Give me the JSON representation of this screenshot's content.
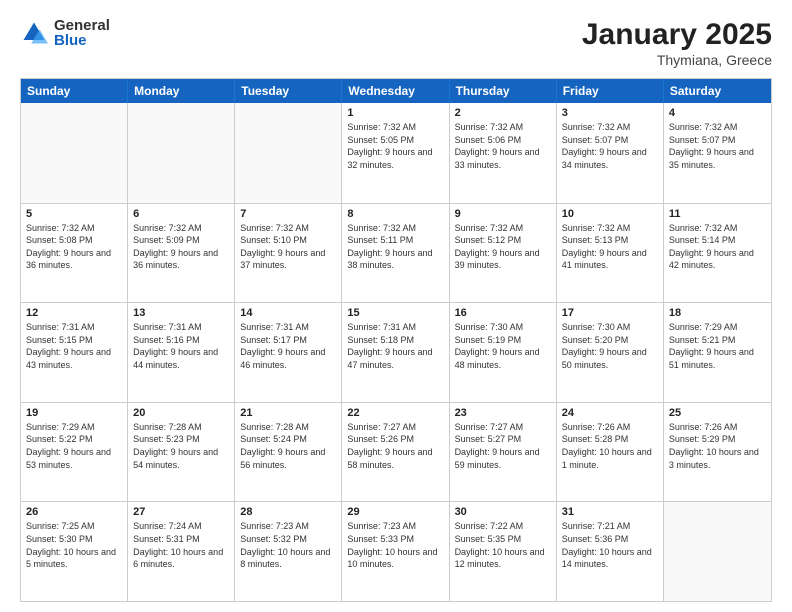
{
  "header": {
    "logo_general": "General",
    "logo_blue": "Blue",
    "title": "January 2025",
    "location": "Thymiana, Greece"
  },
  "weekdays": [
    "Sunday",
    "Monday",
    "Tuesday",
    "Wednesday",
    "Thursday",
    "Friday",
    "Saturday"
  ],
  "weeks": [
    [
      {
        "day": "",
        "info": "",
        "empty": true
      },
      {
        "day": "",
        "info": "",
        "empty": true
      },
      {
        "day": "",
        "info": "",
        "empty": true
      },
      {
        "day": "1",
        "info": "Sunrise: 7:32 AM\nSunset: 5:05 PM\nDaylight: 9 hours and 32 minutes."
      },
      {
        "day": "2",
        "info": "Sunrise: 7:32 AM\nSunset: 5:06 PM\nDaylight: 9 hours and 33 minutes."
      },
      {
        "day": "3",
        "info": "Sunrise: 7:32 AM\nSunset: 5:07 PM\nDaylight: 9 hours and 34 minutes."
      },
      {
        "day": "4",
        "info": "Sunrise: 7:32 AM\nSunset: 5:07 PM\nDaylight: 9 hours and 35 minutes."
      }
    ],
    [
      {
        "day": "5",
        "info": "Sunrise: 7:32 AM\nSunset: 5:08 PM\nDaylight: 9 hours and 36 minutes."
      },
      {
        "day": "6",
        "info": "Sunrise: 7:32 AM\nSunset: 5:09 PM\nDaylight: 9 hours and 36 minutes."
      },
      {
        "day": "7",
        "info": "Sunrise: 7:32 AM\nSunset: 5:10 PM\nDaylight: 9 hours and 37 minutes."
      },
      {
        "day": "8",
        "info": "Sunrise: 7:32 AM\nSunset: 5:11 PM\nDaylight: 9 hours and 38 minutes."
      },
      {
        "day": "9",
        "info": "Sunrise: 7:32 AM\nSunset: 5:12 PM\nDaylight: 9 hours and 39 minutes."
      },
      {
        "day": "10",
        "info": "Sunrise: 7:32 AM\nSunset: 5:13 PM\nDaylight: 9 hours and 41 minutes."
      },
      {
        "day": "11",
        "info": "Sunrise: 7:32 AM\nSunset: 5:14 PM\nDaylight: 9 hours and 42 minutes."
      }
    ],
    [
      {
        "day": "12",
        "info": "Sunrise: 7:31 AM\nSunset: 5:15 PM\nDaylight: 9 hours and 43 minutes."
      },
      {
        "day": "13",
        "info": "Sunrise: 7:31 AM\nSunset: 5:16 PM\nDaylight: 9 hours and 44 minutes."
      },
      {
        "day": "14",
        "info": "Sunrise: 7:31 AM\nSunset: 5:17 PM\nDaylight: 9 hours and 46 minutes."
      },
      {
        "day": "15",
        "info": "Sunrise: 7:31 AM\nSunset: 5:18 PM\nDaylight: 9 hours and 47 minutes."
      },
      {
        "day": "16",
        "info": "Sunrise: 7:30 AM\nSunset: 5:19 PM\nDaylight: 9 hours and 48 minutes."
      },
      {
        "day": "17",
        "info": "Sunrise: 7:30 AM\nSunset: 5:20 PM\nDaylight: 9 hours and 50 minutes."
      },
      {
        "day": "18",
        "info": "Sunrise: 7:29 AM\nSunset: 5:21 PM\nDaylight: 9 hours and 51 minutes."
      }
    ],
    [
      {
        "day": "19",
        "info": "Sunrise: 7:29 AM\nSunset: 5:22 PM\nDaylight: 9 hours and 53 minutes."
      },
      {
        "day": "20",
        "info": "Sunrise: 7:28 AM\nSunset: 5:23 PM\nDaylight: 9 hours and 54 minutes."
      },
      {
        "day": "21",
        "info": "Sunrise: 7:28 AM\nSunset: 5:24 PM\nDaylight: 9 hours and 56 minutes."
      },
      {
        "day": "22",
        "info": "Sunrise: 7:27 AM\nSunset: 5:26 PM\nDaylight: 9 hours and 58 minutes."
      },
      {
        "day": "23",
        "info": "Sunrise: 7:27 AM\nSunset: 5:27 PM\nDaylight: 9 hours and 59 minutes."
      },
      {
        "day": "24",
        "info": "Sunrise: 7:26 AM\nSunset: 5:28 PM\nDaylight: 10 hours and 1 minute."
      },
      {
        "day": "25",
        "info": "Sunrise: 7:26 AM\nSunset: 5:29 PM\nDaylight: 10 hours and 3 minutes."
      }
    ],
    [
      {
        "day": "26",
        "info": "Sunrise: 7:25 AM\nSunset: 5:30 PM\nDaylight: 10 hours and 5 minutes."
      },
      {
        "day": "27",
        "info": "Sunrise: 7:24 AM\nSunset: 5:31 PM\nDaylight: 10 hours and 6 minutes."
      },
      {
        "day": "28",
        "info": "Sunrise: 7:23 AM\nSunset: 5:32 PM\nDaylight: 10 hours and 8 minutes."
      },
      {
        "day": "29",
        "info": "Sunrise: 7:23 AM\nSunset: 5:33 PM\nDaylight: 10 hours and 10 minutes."
      },
      {
        "day": "30",
        "info": "Sunrise: 7:22 AM\nSunset: 5:35 PM\nDaylight: 10 hours and 12 minutes."
      },
      {
        "day": "31",
        "info": "Sunrise: 7:21 AM\nSunset: 5:36 PM\nDaylight: 10 hours and 14 minutes."
      },
      {
        "day": "",
        "info": "",
        "empty": true
      }
    ]
  ]
}
